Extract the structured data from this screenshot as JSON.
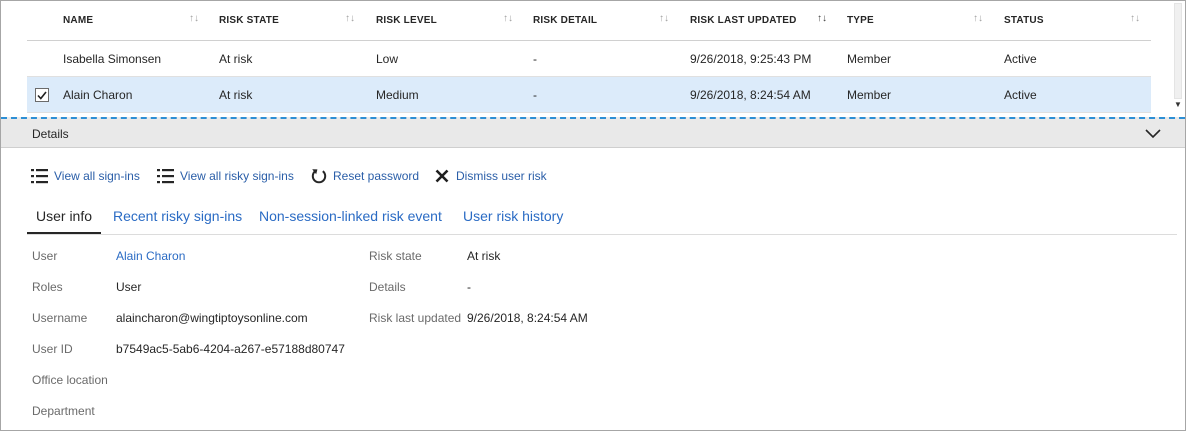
{
  "table": {
    "columns": [
      {
        "label": "NAME",
        "sorted": false
      },
      {
        "label": "RISK STATE",
        "sorted": false
      },
      {
        "label": "RISK LEVEL",
        "sorted": false
      },
      {
        "label": "RISK DETAIL",
        "sorted": false
      },
      {
        "label": "RISK LAST UPDATED",
        "sorted": true
      },
      {
        "label": "TYPE",
        "sorted": false
      },
      {
        "label": "STATUS",
        "sorted": false
      }
    ],
    "rows": [
      {
        "selected": false,
        "cells": [
          "Isabella Simonsen",
          "At risk",
          "Low",
          "-",
          "9/26/2018, 9:25:43 PM",
          "Member",
          "Active"
        ]
      },
      {
        "selected": true,
        "cells": [
          "Alain Charon",
          "At risk",
          "Medium",
          "-",
          "9/26/2018, 8:24:54 AM",
          "Member",
          "Active"
        ]
      }
    ]
  },
  "details": {
    "title": "Details",
    "chevron_icon": "chevron-down-icon"
  },
  "toolbar": {
    "view_signins": "View all sign-ins",
    "view_risky_signins": "View all risky sign-ins",
    "reset_password": "Reset password",
    "dismiss_risk": "Dismiss user risk",
    "icons": {
      "view_signins": "list-icon",
      "view_risky_signins": "list-icon",
      "reset_password": "refresh-icon",
      "dismiss_risk": "close-icon"
    }
  },
  "tabs": [
    {
      "label": "User info",
      "active": true
    },
    {
      "label": "Recent risky sign-ins",
      "active": false
    },
    {
      "label": "Non-session-linked risk event",
      "active": false
    },
    {
      "label": "User risk history",
      "active": false
    }
  ],
  "user_info": {
    "left": [
      {
        "label": "User",
        "value": "Alain Charon",
        "link": true
      },
      {
        "label": "Roles",
        "value": "User",
        "link": false
      },
      {
        "label": "Username",
        "value": "alaincharon@wingtiptoysonline.com",
        "link": false
      },
      {
        "label": "User ID",
        "value": "b7549ac5-5ab6-4204-a267-e57188d80747",
        "link": false
      },
      {
        "label": "Office location",
        "value": "",
        "link": false
      },
      {
        "label": "Department",
        "value": "",
        "link": false
      }
    ],
    "right": [
      {
        "label": "Risk state",
        "value": "At risk"
      },
      {
        "label": "Details",
        "value": "-"
      },
      {
        "label": "Risk last updated",
        "value": "9/26/2018, 8:24:54 AM"
      }
    ]
  },
  "colors": {
    "link": "#2a6bc4",
    "selected_row": "#dcebfa",
    "details_bar": "#e9e9e9",
    "focus_dash": "#2d8fd5"
  }
}
